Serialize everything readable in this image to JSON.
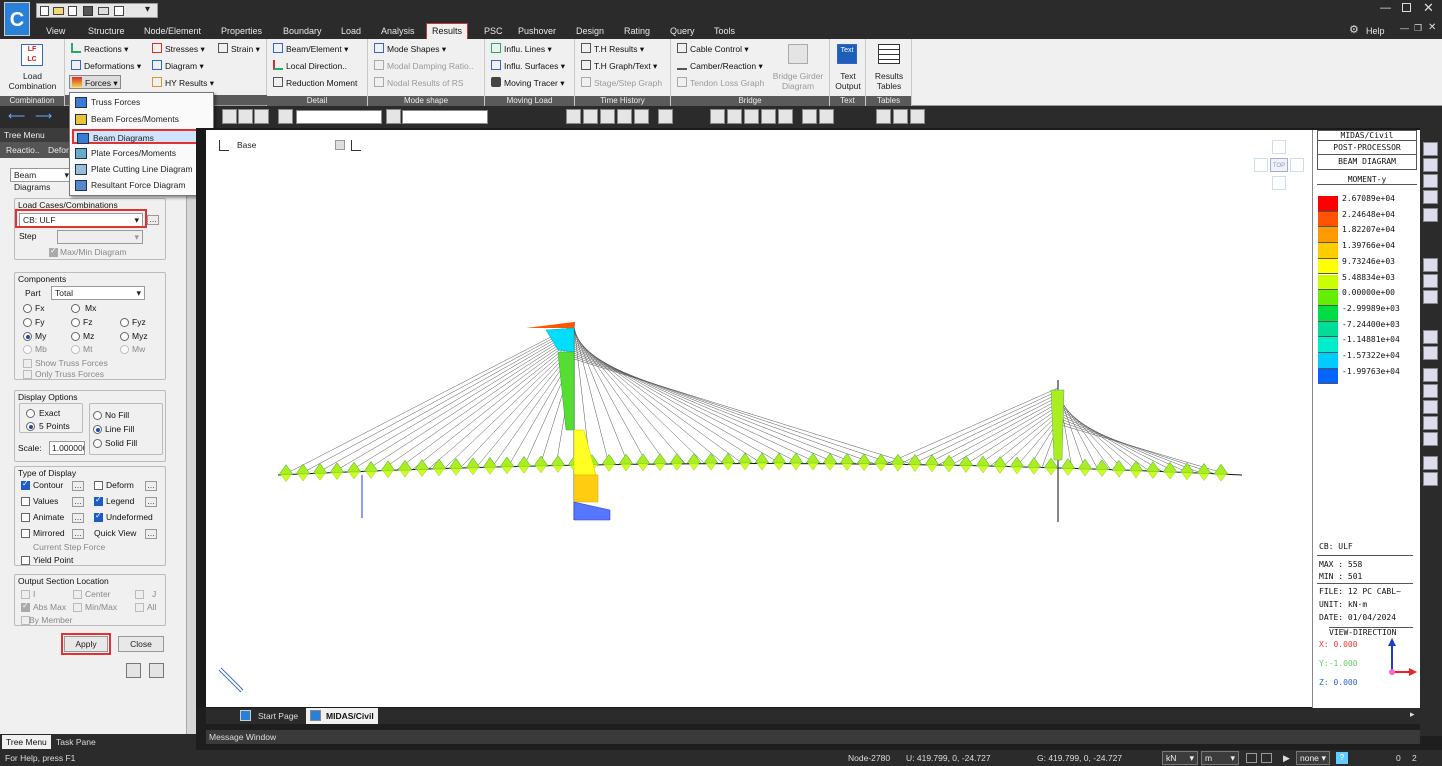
{
  "menubar": {
    "items": [
      "View",
      "Structure",
      "Node/Element",
      "Properties",
      "Boundary",
      "Load",
      "Analysis",
      "Results",
      "PSC",
      "Pushover",
      "Design",
      "Rating",
      "Query",
      "Tools"
    ],
    "active": "Results",
    "help": "Help"
  },
  "ribbon": {
    "combination": {
      "button": "Load\nCombination",
      "label": "Combination"
    },
    "results": {
      "reactions": "Reactions",
      "deformations": "Deformations",
      "forces": "Forces",
      "stresses": "Stresses",
      "diagram": "Diagram",
      "hy_results": "HY Results",
      "strain": "Strain"
    },
    "detail": {
      "beam_element": "Beam/Element",
      "local_direction": "Local Direction..",
      "reduction_moment": "Reduction Moment",
      "label": "Detail"
    },
    "mode_shape": {
      "mode_shapes": "Mode Shapes",
      "modal_damping": "Modal Damping Ratio..",
      "nodal_results": "Nodal Results of RS",
      "label": "Mode shape"
    },
    "moving_load": {
      "influ_lines": "Influ. Lines",
      "influ_surfaces": "Influ. Surfaces",
      "moving_tracer": "Moving Tracer",
      "label": "Moving Load"
    },
    "time_history": {
      "th_results": "T.H Results",
      "th_graph": "T.H Graph/Text",
      "stage_step": "Stage/Step Graph",
      "label": "Time History"
    },
    "bridge": {
      "cable_control": "Cable Control",
      "camber": "Camber/Reaction",
      "tendon_loss": "Tendon Loss Graph",
      "bridge_girder": "Bridge Girder\nDiagram",
      "label": "Bridge"
    },
    "text": {
      "text_output": "Text\nOutput",
      "label": "Text",
      "icon": "Text"
    },
    "tables": {
      "results_tables": "Results\nTables",
      "label": "Tables"
    }
  },
  "forces_dropdown": [
    "Truss Forces",
    "Beam Forces/Moments",
    "Beam Diagrams",
    "Plate Forces/Moments",
    "Plate Cutting Line Diagram",
    "Resultant Force Diagram"
  ],
  "forces_dropdown_selected": "Beam Diagrams",
  "left_panel": {
    "header": "Tree Menu",
    "tabs": [
      "Reactio..",
      "Defor"
    ],
    "function": "Beam Diagrams",
    "load_cases_title": "Load Cases/Combinations",
    "load_case": "CB: ULF",
    "step_label": "Step",
    "max_min": "Max/Min Diagram",
    "components_title": "Components",
    "part_label": "Part",
    "part_value": "Total",
    "components": [
      "Fx",
      "Mx",
      "Fy",
      "Fz",
      "Fyz",
      "My",
      "Mz",
      "Myz",
      "Mb",
      "Mt",
      "Mw"
    ],
    "show_truss": "Show Truss Forces",
    "only_truss": "Only Truss Forces",
    "display_options_title": "Display Options",
    "exact": "Exact",
    "five_points": "5 Points",
    "no_fill": "No Fill",
    "line_fill": "Line Fill",
    "solid_fill": "Solid Fill",
    "scale_label": "Scale:",
    "scale_value": "1.000000",
    "type_display_title": "Type of Display",
    "contour": "Contour",
    "deform": "Deform",
    "values": "Values",
    "legend": "Legend",
    "animate": "Animate",
    "undeformed": "Undeformed",
    "mirrored": "Mirrored",
    "quick_view": "Quick View",
    "current_step": "Current Step Force",
    "yield_point": "Yield Point",
    "output_section_title": "Output Section Location",
    "i": "I",
    "center": "Center",
    "j": "J",
    "abs_max": "Abs Max",
    "min_max": "Min/Max",
    "all": "All",
    "by_member": "By Member",
    "apply": "Apply",
    "close": "Close",
    "bottom_tabs": [
      "Tree Menu",
      "Task Pane"
    ]
  },
  "viewport": {
    "base_label": "Base",
    "view_cube_label": "TOP"
  },
  "legend": {
    "line1": "MIDAS/Civil",
    "line2": "POST-PROCESSOR",
    "line3": "BEAM DIAGRAM",
    "line4": "MOMENT-y",
    "values": [
      "2.67089e+04",
      "2.24648e+04",
      "1.82207e+04",
      "1.39766e+04",
      "9.73246e+03",
      "5.48834e+03",
      "0.00000e+00",
      "-2.99989e+03",
      "-7.24400e+03",
      "-1.14881e+04",
      "-1.57322e+04",
      "-1.99763e+04"
    ],
    "colors": [
      "#ff0000",
      "#ff5500",
      "#ff9900",
      "#ffcc00",
      "#ffff00",
      "#ccff00",
      "#66ee00",
      "#00dd44",
      "#00dd99",
      "#00eecc",
      "#00ccff",
      "#0066ff"
    ],
    "cb": "CB: ULF",
    "max": "MAX : 558",
    "min": "MIN : 501",
    "file": "FILE: 12 PC CABL~",
    "unit": "UNIT: kN·m",
    "date": "DATE: 01/04/2024",
    "view_dir": "VIEW-DIRECTION",
    "x": "X: 0.000",
    "y": "Y:-1.000",
    "z": "Z: 0.000"
  },
  "doc_tabs": [
    "Start Page",
    "MIDAS/Civil"
  ],
  "message_window": "Message Window",
  "status": {
    "help": "For Help, press F1",
    "node": "Node-2780",
    "u": "U: 419.799, 0, -24.727",
    "g": "G: 419.799, 0, -24.727",
    "force_unit": "kN",
    "length_unit": "m",
    "none": "none",
    "num1": "0",
    "num2": "2"
  },
  "colors": {
    "accent": "#d33",
    "ribbon_bg": "#f0f0f0",
    "dark": "#2b2b2b"
  }
}
